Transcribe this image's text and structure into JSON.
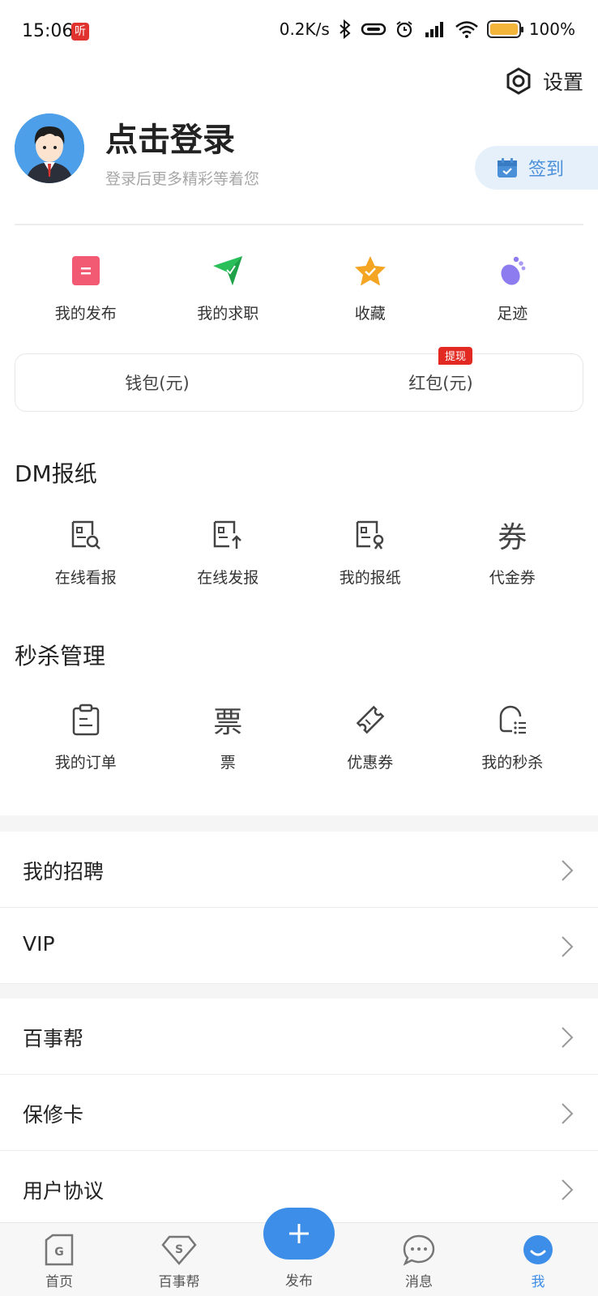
{
  "status_bar": {
    "time": "15:06",
    "app_badge": "听",
    "network_speed": "0.2K/s",
    "battery_text": "100%",
    "battery_level": 1.0
  },
  "header": {
    "settings_label": "设置"
  },
  "profile": {
    "title": "点击登录",
    "subtitle": "登录后更多精彩等着您",
    "checkin_label": "签到"
  },
  "quick_actions": [
    {
      "label": "我的发布",
      "icon": "document-icon",
      "color": "#f25a73"
    },
    {
      "label": "我的求职",
      "icon": "send-icon",
      "color": "#2bbf5a"
    },
    {
      "label": "收藏",
      "icon": "star-icon",
      "color": "#f5a524"
    },
    {
      "label": "足迹",
      "icon": "footprint-icon",
      "color": "#8c7cf0"
    }
  ],
  "wallet": {
    "wallet_label": "钱包(元)",
    "redpack_label": "红包(元)",
    "withdraw_badge": "提现"
  },
  "dm_section": {
    "title": "DM报纸",
    "items": [
      {
        "label": "在线看报",
        "icon": "newspaper-search-icon"
      },
      {
        "label": "在线发报",
        "icon": "newspaper-upload-icon"
      },
      {
        "label": "我的报纸",
        "icon": "newspaper-user-icon"
      },
      {
        "label": "代金券",
        "icon": "voucher-icon",
        "glyph": "券"
      }
    ]
  },
  "flash_section": {
    "title": "秒杀管理",
    "items": [
      {
        "label": "我的订单",
        "icon": "clipboard-icon"
      },
      {
        "label": "票",
        "icon": "ticket-icon",
        "glyph": "票"
      },
      {
        "label": "优惠券",
        "icon": "coupon-icon"
      },
      {
        "label": "我的秒杀",
        "icon": "flash-sale-icon"
      }
    ]
  },
  "menu_group1": [
    "我的招聘",
    "VIP"
  ],
  "menu_group2": [
    "百事帮",
    "保修卡",
    "用户协议"
  ],
  "tab_bar": {
    "home": "首页",
    "baishibang": "百事帮",
    "publish": "发布",
    "messages": "消息",
    "me": "我"
  },
  "colors": {
    "accent": "#3d8ee8",
    "badge_red": "#e22a22",
    "checkin_bg": "#e6f0fb"
  }
}
